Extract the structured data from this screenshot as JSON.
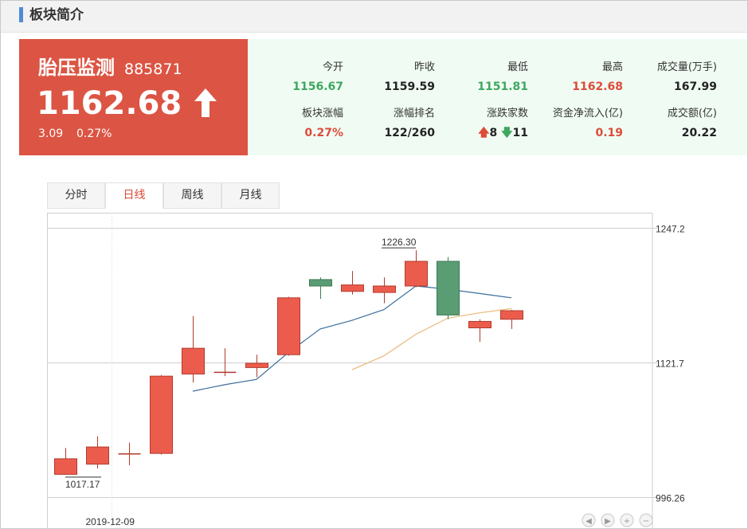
{
  "section": {
    "title": "板块简介"
  },
  "quote": {
    "name": "胎压监测",
    "code": "885871",
    "price": "1162.68",
    "change": "3.09",
    "change_pct": "0.27%",
    "accent_color": "#dc5443"
  },
  "stats": [
    {
      "label": "今开",
      "value": "1156.67",
      "color": "green"
    },
    {
      "label": "昨收",
      "value": "1159.59",
      "color": "dark"
    },
    {
      "label": "最低",
      "value": "1151.81",
      "color": "green"
    },
    {
      "label": "最高",
      "value": "1162.68",
      "color": "red"
    },
    {
      "label": "成交量(万手)",
      "value": "167.99",
      "color": "dark"
    },
    {
      "label": "板块涨幅",
      "value": "0.27%",
      "color": "red"
    },
    {
      "label": "涨幅排名",
      "value": "122/260",
      "color": "dark"
    },
    {
      "label": "涨跌家数",
      "value": "",
      "color": "dark"
    },
    {
      "label": "资金净流入(亿)",
      "value": "0.19",
      "color": "red"
    },
    {
      "label": "成交额(亿)",
      "value": "20.22",
      "color": "dark"
    }
  ],
  "up_down": {
    "up": "8",
    "down": "11"
  },
  "tabs": [
    {
      "label": "分时",
      "active": false
    },
    {
      "label": "日线",
      "active": true
    },
    {
      "label": "周线",
      "active": false
    },
    {
      "label": "月线",
      "active": false
    }
  ],
  "chart_data": {
    "type": "candlestick",
    "y_axis_labels": [
      "1247.2",
      "1121.7",
      "996.26"
    ],
    "x_axis_labels": [
      "2019-12-09"
    ],
    "high_annotation": "1226.30",
    "low_annotation": "1017.17",
    "up_color": "#ec5c4c",
    "down_color": "#5a9c73",
    "ma_colors": [
      "#3c6e9c",
      "#e8b878"
    ],
    "candles": [
      {
        "open": 1017.5,
        "close": 1032.0,
        "high": 1042.0,
        "low": 1017.17
      },
      {
        "open": 1027.0,
        "close": 1043.0,
        "high": 1053.0,
        "low": 1023.0
      },
      {
        "open": 1036.5,
        "close": 1036.5,
        "high": 1047.0,
        "low": 1026.0
      },
      {
        "open": 1037.0,
        "close": 1109.0,
        "high": 1110.0,
        "low": 1036.0
      },
      {
        "open": 1111.0,
        "close": 1135.0,
        "high": 1165.0,
        "low": 1103.0
      },
      {
        "open": 1112.5,
        "close": 1112.5,
        "high": 1135.0,
        "low": 1109.0
      },
      {
        "open": 1117.0,
        "close": 1121.0,
        "high": 1129.0,
        "low": 1108.0
      },
      {
        "open": 1129.0,
        "close": 1182.0,
        "high": 1183.0,
        "low": 1128.0
      },
      {
        "open": 1199.0,
        "close": 1193.0,
        "high": 1201.0,
        "low": 1181.0
      },
      {
        "open": 1188.0,
        "close": 1194.0,
        "high": 1207.0,
        "low": 1185.0
      },
      {
        "open": 1187.0,
        "close": 1193.0,
        "high": 1201.0,
        "low": 1177.0
      },
      {
        "open": 1193.0,
        "close": 1216.0,
        "high": 1226.3,
        "low": 1192.0
      },
      {
        "open": 1216.0,
        "close": 1166.0,
        "high": 1220.0,
        "low": 1162.0
      },
      {
        "open": 1154.0,
        "close": 1160.0,
        "high": 1162.0,
        "low": 1141.0
      },
      {
        "open": 1162.0,
        "close": 1170.0,
        "high": 1171.0,
        "low": 1153.0
      }
    ],
    "ma1": [
      null,
      null,
      null,
      null,
      1095.0,
      1101.0,
      1106.0,
      1131.0,
      1153.0,
      1161.0,
      1171.0,
      1193.0,
      1190.0,
      1186.0,
      1182.0
    ],
    "ma2": [
      null,
      null,
      null,
      null,
      null,
      null,
      null,
      null,
      null,
      1115.0,
      1128.0,
      1148.0,
      1163.0,
      1168.0,
      1172.0
    ],
    "ylim": [
      996.26,
      1247.2
    ]
  }
}
